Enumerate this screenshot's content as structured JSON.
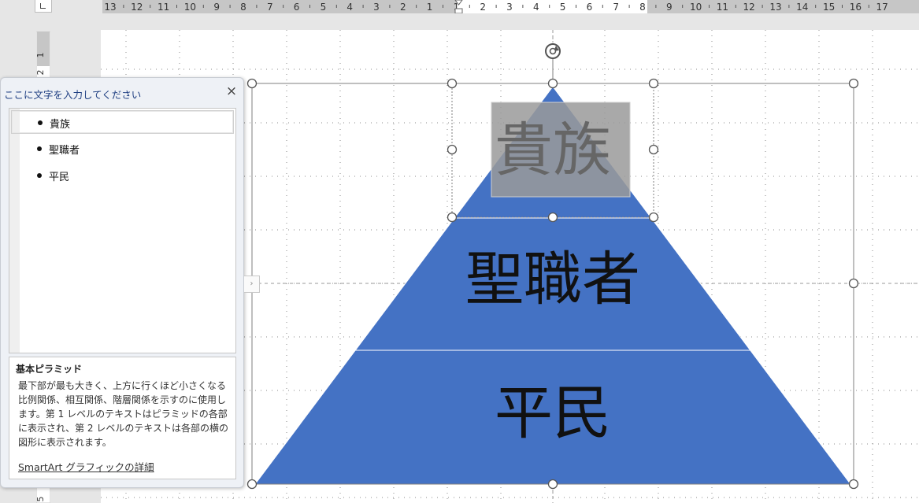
{
  "ruler": {
    "top_labels": [
      "13",
      "12",
      "11",
      "10",
      "9",
      "8",
      "7",
      "6",
      "5",
      "4",
      "3",
      "2",
      "1",
      "1",
      "2",
      "3",
      "4",
      "5",
      "6",
      "7",
      "8",
      "9",
      "10",
      "11",
      "12",
      "13",
      "14",
      "15",
      "16",
      "17"
    ],
    "left_labels": [
      "1",
      "2",
      "5"
    ]
  },
  "diagram": {
    "type": "basic-pyramid",
    "fill_color": "#4472c4",
    "top_label_color": "#666666",
    "top_highlight_color": "#9a9a9a",
    "levels": [
      {
        "label": "貴族"
      },
      {
        "label": "聖職者"
      },
      {
        "label": "平民"
      }
    ]
  },
  "text_pane": {
    "title": "ここに文字を入力してください",
    "close_icon": "×",
    "items": [
      "貴族",
      "聖職者",
      "平民"
    ],
    "desc_title": "基本ピラミッド",
    "desc_body": [
      "最下部が最も大きく、上方に行くほど小さくなる比例関係、相互関係、階層関係を示すのに使用します。第 1 レベルのテキストはピラミッドの各部に表示され、第 2 レベルのテキストは各部の横の図形に表示されます。"
    ],
    "link": "SmartArt グラフィックの詳細",
    "expander_icon": "›"
  }
}
